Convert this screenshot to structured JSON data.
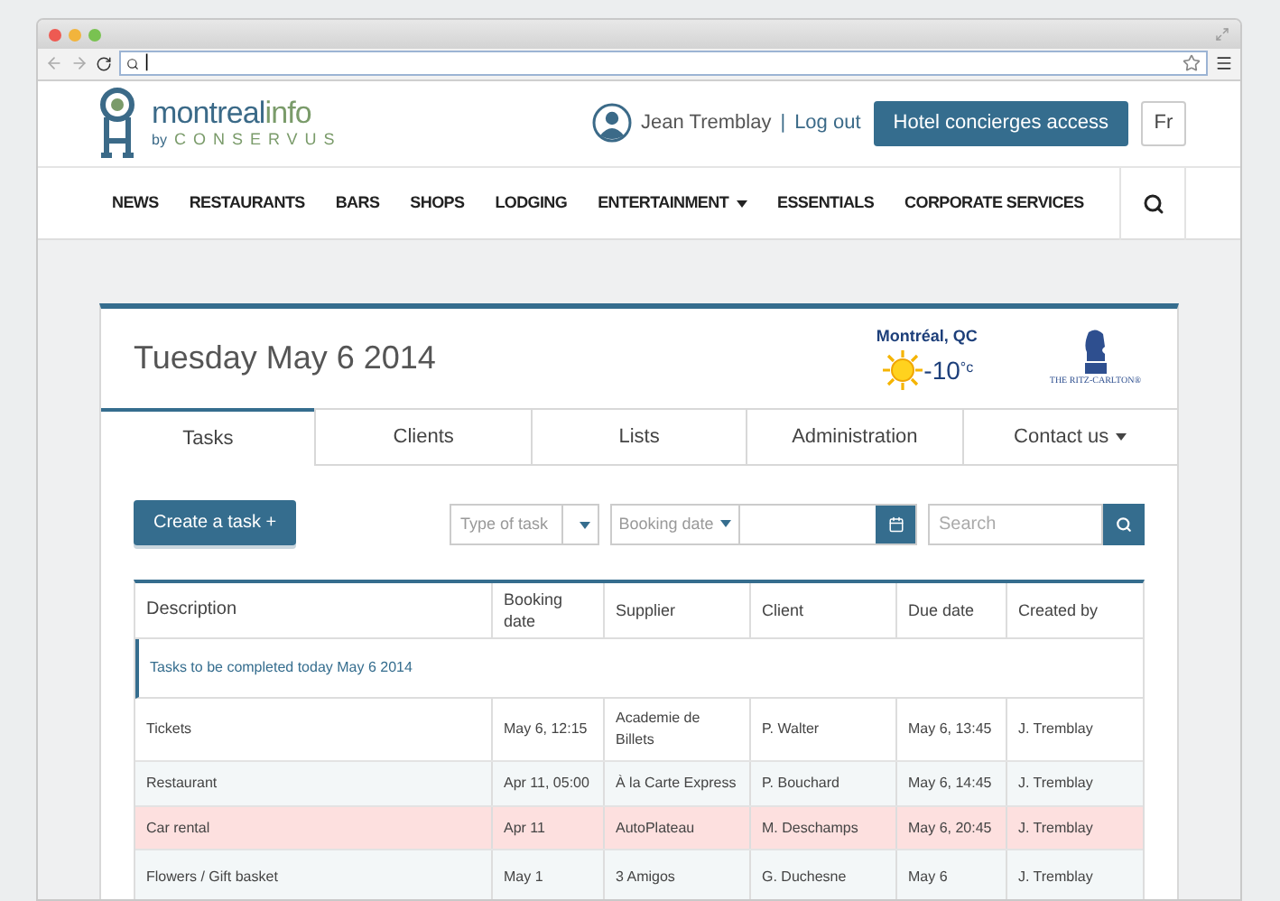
{
  "browser": {
    "address": "|"
  },
  "logo": {
    "name_first": "montreal",
    "name_second": "info",
    "by": "by",
    "company": "CONSERVUS"
  },
  "user": {
    "name": "Jean Tremblay",
    "separator": "|",
    "logout": "Log out"
  },
  "access_button": "Hotel concierges access",
  "language_button": "Fr",
  "nav": [
    {
      "label": "NEWS",
      "has_menu": false
    },
    {
      "label": "RESTAURANTS",
      "has_menu": false
    },
    {
      "label": "BARS",
      "has_menu": false
    },
    {
      "label": "SHOPS",
      "has_menu": false
    },
    {
      "label": "LODGING",
      "has_menu": false
    },
    {
      "label": "ENTERTAINMENT",
      "has_menu": true
    },
    {
      "label": "ESSENTIALS",
      "has_menu": false
    },
    {
      "label": "CORPORATE SERVICES",
      "has_menu": false
    }
  ],
  "date_title": "Tuesday May 6 2014",
  "weather": {
    "city": "Montréal, QC",
    "temperature": "-10$^{°c}$"
  },
  "hotel_logo": "THE RITZ-CARLTON®",
  "tabs": [
    {
      "label": "Tasks",
      "selected": true,
      "has_menu": false
    },
    {
      "label": "Clients",
      "selected": false,
      "has_menu": false
    },
    {
      "label": "Lists",
      "selected": false,
      "has_menu": false
    },
    {
      "label": "Administration",
      "selected": false,
      "has_menu": false
    },
    {
      "label": "Contact us",
      "selected": false,
      "has_menu": true
    }
  ],
  "create_button": "Create a task +",
  "filters": {
    "type_placeholder": "Type of task",
    "date_filter": "Booking date",
    "search_placeholder": "Search"
  },
  "table": {
    "columns": [
      "Description",
      "Booking date",
      "Supplier",
      "Client",
      "Due date",
      "Created by"
    ],
    "group": "Tasks to be completed today May 6 2014",
    "rows": [
      {
        "cells": [
          "Tickets",
          "May 6, 12:15",
          "Academie de Billets",
          "P. Walter",
          "May 6, 13:45",
          "J. Tremblay"
        ],
        "highlighted": false
      },
      {
        "cells": [
          "Restaurant",
          "Apr 11, 05:00",
          "À la Carte Express",
          "P. Bouchard",
          "May 6, 14:45",
          "J. Tremblay"
        ],
        "highlighted": false
      },
      {
        "cells": [
          "Car rental",
          "Apr 11",
          "AutoPlateau",
          "M. Deschamps",
          "May 6, 20:45",
          "J. Tremblay"
        ],
        "highlighted": true
      },
      {
        "cells": [
          "Flowers / Gift basket",
          "May 1",
          "3 Amigos",
          "G. Duchesne",
          "May 6",
          "J. Tremblay"
        ],
        "highlighted": false
      }
    ]
  }
}
